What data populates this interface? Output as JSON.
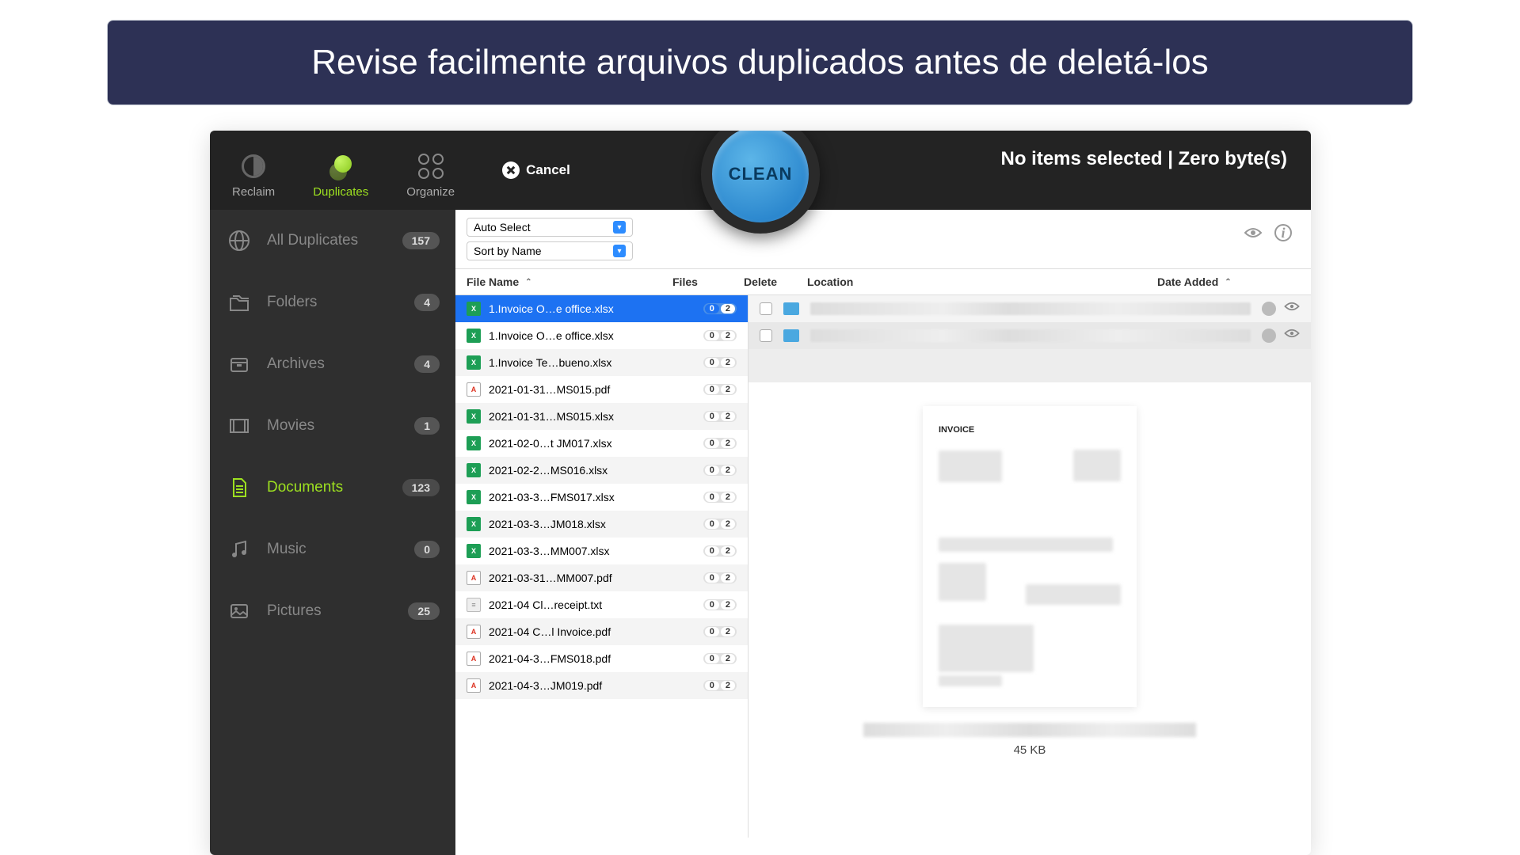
{
  "banner": "Revise facilmente arquivos duplicados antes de deletá-los",
  "topbar": {
    "tabs": {
      "reclaim": "Reclaim",
      "duplicates": "Duplicates",
      "organize": "Organize"
    },
    "cancel": "Cancel",
    "clean": "CLEAN"
  },
  "status": "No items selected | Zero byte(s)",
  "dropdowns": {
    "auto_select": "Auto Select",
    "sort": "Sort by Name"
  },
  "sidebar": [
    {
      "icon": "globe",
      "label": "All Duplicates",
      "count": "157"
    },
    {
      "icon": "folders",
      "label": "Folders",
      "count": "4"
    },
    {
      "icon": "archives",
      "label": "Archives",
      "count": "4"
    },
    {
      "icon": "movies",
      "label": "Movies",
      "count": "1"
    },
    {
      "icon": "documents",
      "label": "Documents",
      "count": "123",
      "active": true
    },
    {
      "icon": "music",
      "label": "Music",
      "count": "0"
    },
    {
      "icon": "pictures",
      "label": "Pictures",
      "count": "25"
    }
  ],
  "columns": {
    "name": "File Name",
    "files": "Files",
    "delete": "Delete",
    "location": "Location",
    "date": "Date Added"
  },
  "files": [
    {
      "type": "xlsx",
      "name": "1.Invoice O…e office.xlsx",
      "p1": "0",
      "p2": "2",
      "selected": true
    },
    {
      "type": "xlsx",
      "name": "1.Invoice O…e office.xlsx",
      "p1": "0",
      "p2": "2"
    },
    {
      "type": "xlsx",
      "name": "1.Invoice Te…bueno.xlsx",
      "p1": "0",
      "p2": "2"
    },
    {
      "type": "pdf",
      "name": "2021-01-31…MS015.pdf",
      "p1": "0",
      "p2": "2"
    },
    {
      "type": "xlsx",
      "name": "2021-01-31…MS015.xlsx",
      "p1": "0",
      "p2": "2"
    },
    {
      "type": "xlsx",
      "name": "2021-02-0…t JM017.xlsx",
      "p1": "0",
      "p2": "2"
    },
    {
      "type": "xlsx",
      "name": "2021-02-2…MS016.xlsx",
      "p1": "0",
      "p2": "2"
    },
    {
      "type": "xlsx",
      "name": "2021-03-3…FMS017.xlsx",
      "p1": "0",
      "p2": "2"
    },
    {
      "type": "xlsx",
      "name": "2021-03-3…JM018.xlsx",
      "p1": "0",
      "p2": "2"
    },
    {
      "type": "xlsx",
      "name": "2021-03-3…MM007.xlsx",
      "p1": "0",
      "p2": "2"
    },
    {
      "type": "pdf",
      "name": "2021-03-31…MM007.pdf",
      "p1": "0",
      "p2": "2"
    },
    {
      "type": "txt",
      "name": "2021-04 Cl…receipt.txt",
      "p1": "0",
      "p2": "2"
    },
    {
      "type": "pdf",
      "name": "2021-04 C…l Invoice.pdf",
      "p1": "0",
      "p2": "2"
    },
    {
      "type": "pdf",
      "name": "2021-04-3…FMS018.pdf",
      "p1": "0",
      "p2": "2"
    },
    {
      "type": "pdf",
      "name": "2021-04-3…JM019.pdf",
      "p1": "0",
      "p2": "2"
    }
  ],
  "preview": {
    "title": "INVOICE",
    "size": "45 KB"
  }
}
